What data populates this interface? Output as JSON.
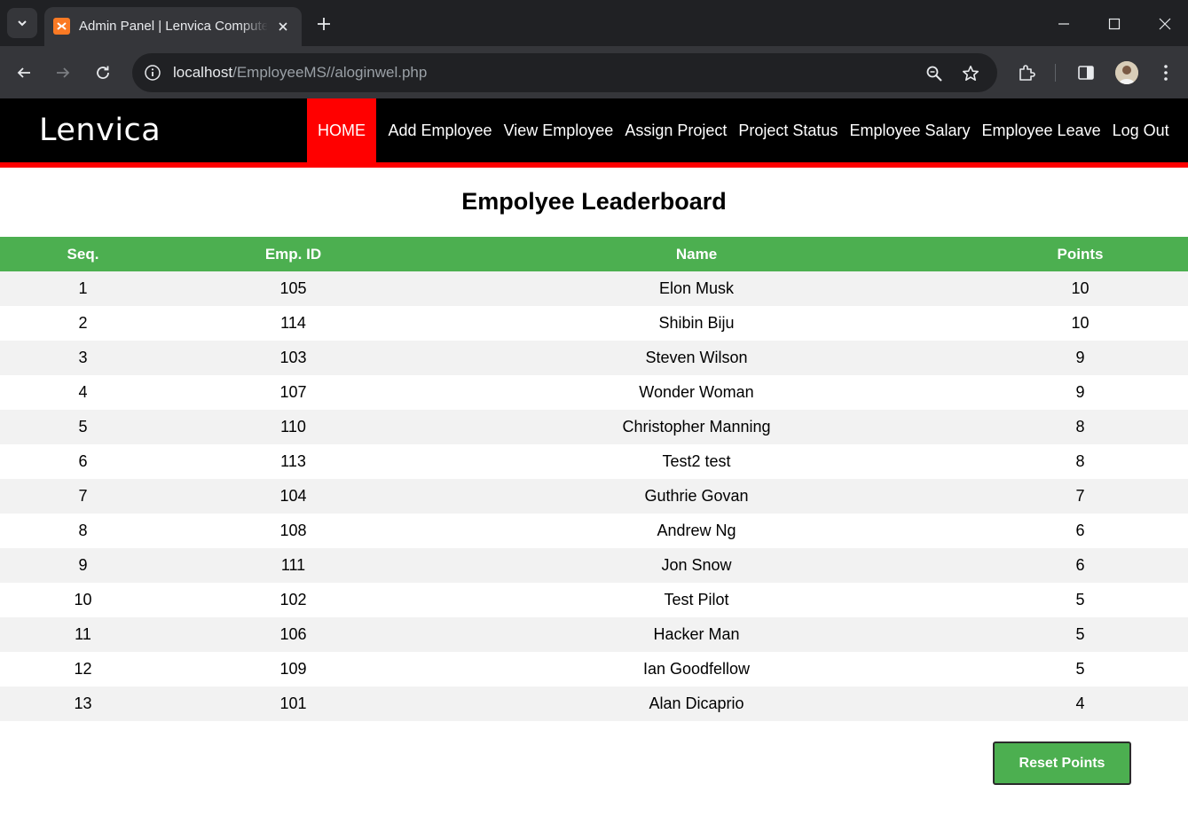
{
  "browser": {
    "tab_title": "Admin Panel | Lenvica Computers",
    "url_host": "localhost",
    "url_path": "/EmployeeMS//aloginwel.php"
  },
  "site": {
    "logo": "Lenvica",
    "nav": [
      {
        "label": "HOME",
        "active": true
      },
      {
        "label": "Add Employee"
      },
      {
        "label": "View Employee"
      },
      {
        "label": "Assign Project"
      },
      {
        "label": "Project Status"
      },
      {
        "label": "Employee Salary"
      },
      {
        "label": "Employee Leave"
      },
      {
        "label": "Log Out"
      }
    ],
    "accent_color": "#ff0000",
    "table_header_color": "#4caf50"
  },
  "leaderboard": {
    "title": "Empolyee Leaderboard",
    "columns": [
      "Seq.",
      "Emp. ID",
      "Name",
      "Points"
    ],
    "rows": [
      [
        "1",
        "105",
        "Elon Musk",
        "10"
      ],
      [
        "2",
        "114",
        "Shibin Biju",
        "10"
      ],
      [
        "3",
        "103",
        "Steven Wilson",
        "9"
      ],
      [
        "4",
        "107",
        "Wonder Woman",
        "9"
      ],
      [
        "5",
        "110",
        "Christopher Manning",
        "8"
      ],
      [
        "6",
        "113",
        "Test2 test",
        "8"
      ],
      [
        "7",
        "104",
        "Guthrie Govan",
        "7"
      ],
      [
        "8",
        "108",
        "Andrew Ng",
        "6"
      ],
      [
        "9",
        "111",
        "Jon Snow",
        "6"
      ],
      [
        "10",
        "102",
        "Test Pilot",
        "5"
      ],
      [
        "11",
        "106",
        "Hacker Man",
        "5"
      ],
      [
        "12",
        "109",
        "Ian Goodfellow",
        "5"
      ],
      [
        "13",
        "101",
        "Alan Dicaprio",
        "4"
      ]
    ],
    "reset_label": "Reset Points"
  }
}
